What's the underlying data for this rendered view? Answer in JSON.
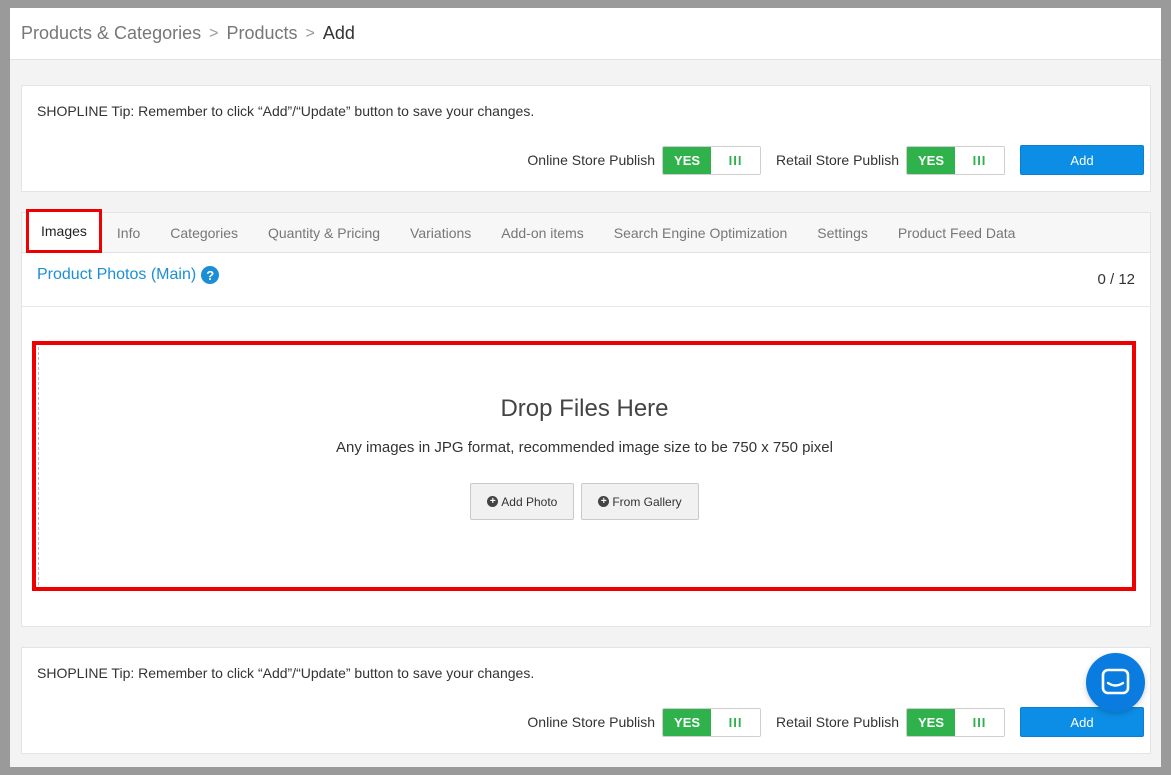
{
  "breadcrumb": {
    "items": [
      "Products & Categories",
      "Products"
    ],
    "current": "Add"
  },
  "tip_text": "SHOPLINE Tip: Remember to click “Add”/“Update” button to save your changes.",
  "publish": {
    "online_label": "Online Store Publish",
    "retail_label": "Retail Store Publish",
    "toggle_on": "YES",
    "toggle_knob": "III",
    "add_label": "Add"
  },
  "tabs": [
    "Images",
    "Info",
    "Categories",
    "Quantity & Pricing",
    "Variations",
    "Add-on items",
    "Search Engine Optimization",
    "Settings",
    "Product Feed Data"
  ],
  "photos": {
    "title": "Product Photos (Main)",
    "help": "?",
    "count": "0 / 12"
  },
  "dropzone": {
    "title": "Drop Files Here",
    "subtitle": "Any images in JPG format, recommended image size to be 750 x 750 pixel",
    "add_photo": "Add Photo",
    "from_gallery": "From Gallery"
  },
  "colors": {
    "accent_blue": "#0c8ee6",
    "toggle_green": "#2fb24c",
    "highlight_red": "#ee0000"
  },
  "icons": {
    "plus": "+",
    "chat": "chat-icon"
  }
}
